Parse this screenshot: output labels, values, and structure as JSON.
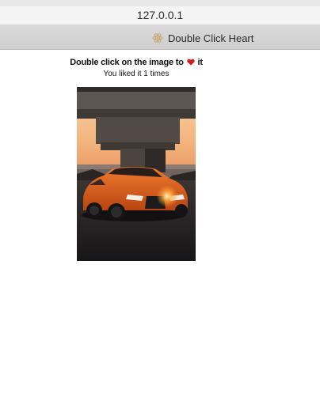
{
  "browser": {
    "url": "127.0.0.1",
    "tab_title": "Double Click Heart",
    "tab_icon": "react-atom-icon"
  },
  "page": {
    "instruction_before": "Double click on the image to",
    "instruction_after": "it",
    "heart_icon": "heart-icon",
    "like_text": "You liked it 1 times"
  },
  "photo": {
    "subject": "orange car under bridge at sunset",
    "colors": {
      "sky": "#f4c08e",
      "bridge": "#4b4540",
      "car": "#e0621c",
      "ground": "#1e1d1f"
    }
  },
  "colors": {
    "heart": "#d71a1a",
    "tab_bar": "#d4d4d4",
    "address_bar": "#f4f4f4"
  }
}
